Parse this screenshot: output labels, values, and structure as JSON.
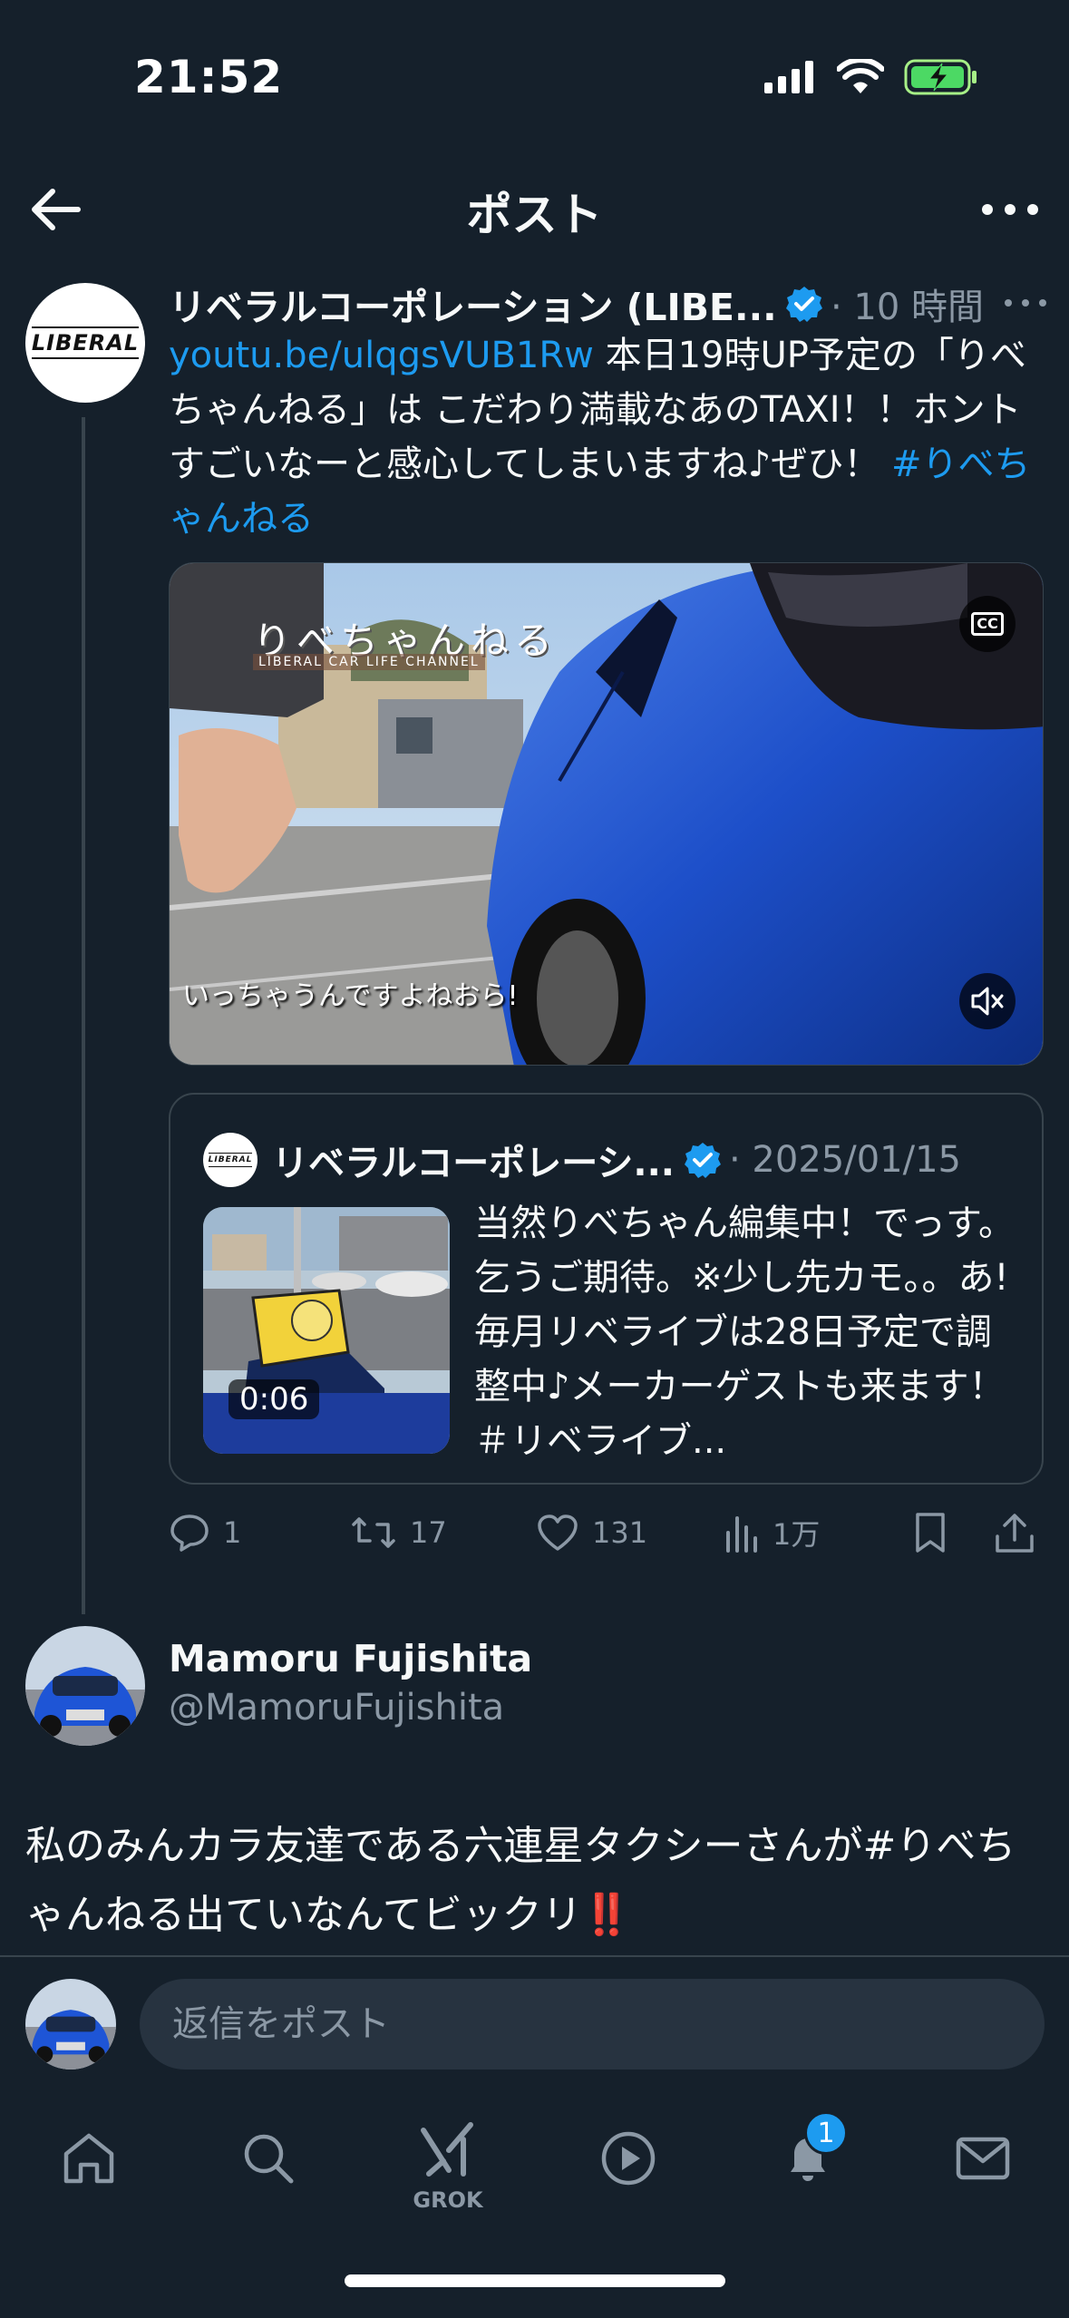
{
  "status_bar": {
    "time": "21:52"
  },
  "header": {
    "title": "ポスト"
  },
  "tweet": {
    "author_name": "リベラルコーポレーション (LIBE...",
    "time": "· 10 時間",
    "avatar_logo": "LIBERAL",
    "text_link": "youtu.be/ulqgsVUB1Rw",
    "text_body": " 本日19時UP予定の「りべちゃんねる」は こだわり満載なあのTAXI！！ホントすごいなーと感心してしまいますね♪ぜひ！ ",
    "hashtag": "#りべちゃんねる",
    "video": {
      "logo": "りべちゃんねる",
      "logo_sub": "LIBERAL CAR LIFE CHANNEL",
      "caption": "いっちゃうんですよねおら!",
      "cc_label": "CC"
    },
    "quote": {
      "author_name": "リベラルコーポレーシ...",
      "date": "· 2025/01/15",
      "duration": "0:06",
      "text": "当然りべちゃん編集中！でっす。乞うご期待。※少し先カモ。。あ!毎月リベライブは28日予定で調整中♪メーカーゲストも来ます！＃リベライブ..."
    },
    "actions": {
      "replies": "1",
      "reposts": "17",
      "likes": "131",
      "views": "1万"
    }
  },
  "reply": {
    "name": "Mamoru Fujishita",
    "handle": "@MamoruFujishita",
    "text": "私のみんカラ友達である六連星タクシーさんが#りべちゃんねる出ていなんてビックリ",
    "emoji": "‼️"
  },
  "compose": {
    "placeholder": "返信をポスト"
  },
  "nav": {
    "grok_label": "GROK",
    "notifications_badge": "1"
  },
  "colors": {
    "background": "#15202b",
    "accent": "#1d9bf0",
    "muted": "#8b98a5",
    "border": "#38444d"
  }
}
